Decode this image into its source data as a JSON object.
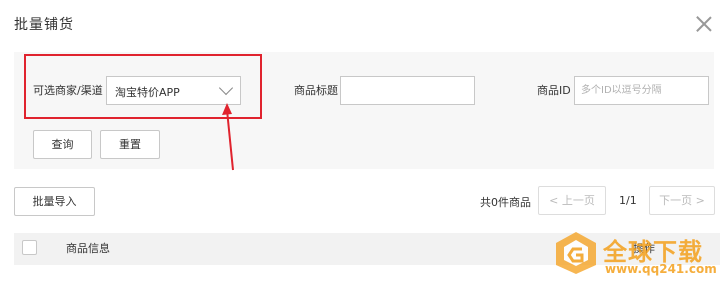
{
  "dialog": {
    "title": "批量铺货",
    "close_icon": "close-icon"
  },
  "filters": {
    "merchant_label": "可选商家/渠道",
    "merchant_selected": "淘宝特价APP",
    "product_title_label": "商品标题",
    "product_title_value": "",
    "product_id_label": "商品ID",
    "product_id_placeholder": "多个ID以逗号分隔",
    "query_button": "查询",
    "reset_button": "重置"
  },
  "toolbar": {
    "import_button": "批量导入",
    "total_text": "共0件商品",
    "prev_button": "< 上一页",
    "page_indicator": "1/1",
    "next_button": "下一页 >"
  },
  "table": {
    "columns": [
      "商品信息",
      "操作"
    ]
  },
  "annotation": {
    "highlight_color": "#e0232e",
    "arrow_color": "#e0232e"
  },
  "watermark": {
    "title": "全球下载",
    "url": "www.qq241.com",
    "color": "#f4a01c"
  }
}
